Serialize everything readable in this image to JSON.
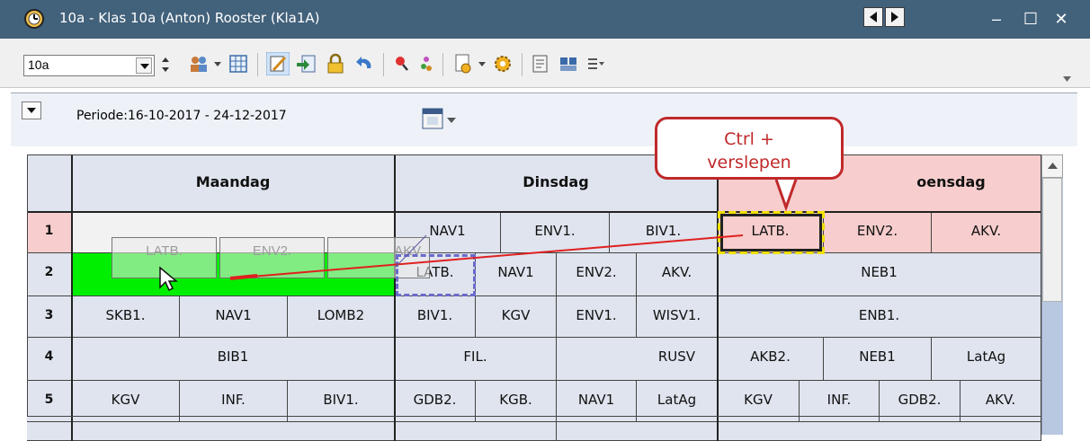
{
  "window": {
    "title": "10a - Klas 10a (Anton)  Rooster  (Kla1A)",
    "buttons": {
      "minimize": "–",
      "maximize": "☐",
      "close": "✕"
    }
  },
  "toolbar": {
    "class_select": {
      "value": "10a"
    },
    "icons": [
      "class-group-icon",
      "grid-view-icon",
      "edit-schedule-icon",
      "import-icon",
      "lock-icon",
      "undo-icon",
      "search-icon",
      "people-icon",
      "document-gear-icon",
      "gear-icon",
      "export-icon",
      "teams-icon",
      "menu-list-icon"
    ]
  },
  "period": {
    "label": "Periode:16-10-2017 - 24-12-2017"
  },
  "schedule": {
    "days": [
      "Maandag",
      "Dinsdag",
      "oensdag"
    ],
    "hours": [
      "1",
      "2",
      "3",
      "4",
      "5"
    ],
    "row1": {
      "ghosts": [
        "LATB.",
        "ENV2.",
        "AKV."
      ],
      "dinsdag": [
        "NAV1",
        "ENV1.",
        "BIV1."
      ],
      "woensdag": [
        "LATB.",
        "ENV2.",
        "AKV."
      ]
    },
    "row2": {
      "dinsdag": [
        "LATB.",
        "NAV1",
        "ENV2.",
        "AKV."
      ],
      "woensdag": [
        "NEB1"
      ]
    },
    "row3": {
      "maandag": [
        "SKB1.",
        "NAV1",
        "LOMB2"
      ],
      "dinsdag": [
        "BIV1.",
        "KGV",
        "ENV1.",
        "WISV1."
      ],
      "woensdag": [
        "ENB1."
      ]
    },
    "row4": {
      "maandag": [
        "BIB1"
      ],
      "dinsdag": [
        "FIL.",
        "RUSV"
      ],
      "woensdag": [
        "AKB2.",
        "NEB1",
        "LatAg"
      ]
    },
    "row5": {
      "maandag": [
        "KGV",
        "INF.",
        "BIV1."
      ],
      "dinsdag": [
        "GDB2.",
        "KGB.",
        "NAV1",
        "LatAg"
      ],
      "woensdag": [
        "KGV",
        "INF.",
        "GDB2.",
        "AKV."
      ]
    }
  },
  "callout": {
    "line1": "Ctrl +",
    "line2": "verslepen"
  },
  "colors": {
    "titlebar": "#42617b",
    "highlight_pink": "#f7cdcd",
    "drop_green": "#00ee00",
    "callout_red": "#c0292a"
  }
}
